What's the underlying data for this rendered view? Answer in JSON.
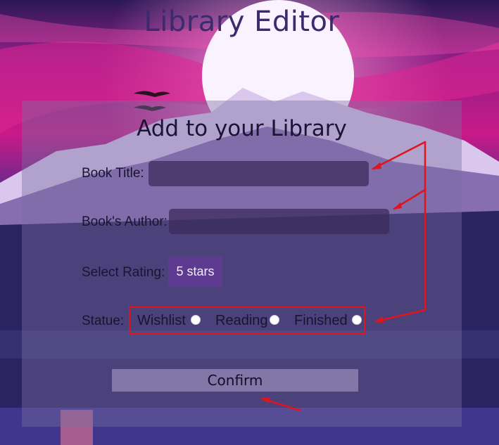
{
  "app_title": "Library Editor",
  "form": {
    "title": "Add to your Library",
    "book_title_label": "Book Title:",
    "book_title_value": "",
    "author_label": "Book's Author:",
    "author_value": "",
    "rating_label": "Select Rating:",
    "rating_selected": "5 stars",
    "status_label": "Statue:",
    "status_options": [
      "Wishlist",
      "Reading",
      "Finished"
    ],
    "confirm_label": "Confirm"
  },
  "colors": {
    "annotation": "#e0141c",
    "panel": "#786ea0",
    "rating_select": "#5e3a90"
  }
}
